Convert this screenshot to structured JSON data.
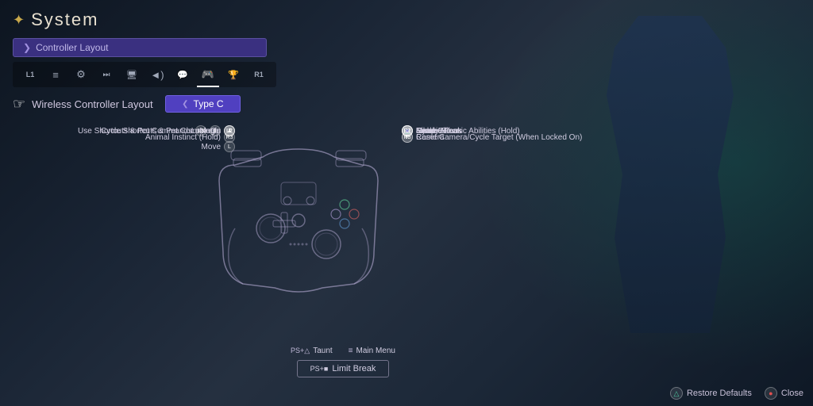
{
  "header": {
    "icon": "✦",
    "title": "System"
  },
  "controller_layout_bar": {
    "arrow": "❯",
    "label": "Controller Layout"
  },
  "tabs": [
    {
      "id": "l1",
      "label": "L1",
      "icon": "L1"
    },
    {
      "id": "list",
      "label": "≡",
      "icon": "≡"
    },
    {
      "id": "gear",
      "label": "⚙",
      "icon": "⚙"
    },
    {
      "id": "media",
      "label": "▶|",
      "icon": "▶|"
    },
    {
      "id": "display",
      "label": "□",
      "icon": "□"
    },
    {
      "id": "sound",
      "label": "♪",
      "icon": "◄►"
    },
    {
      "id": "speech",
      "label": "💬",
      "icon": "💬"
    },
    {
      "id": "controller",
      "label": "🎮",
      "icon": "🎮",
      "active": true
    },
    {
      "id": "trophy",
      "label": "🏆",
      "icon": "🏆"
    },
    {
      "id": "r1",
      "label": "R1",
      "icon": "R1"
    }
  ],
  "wireless_setting": {
    "label": "Wireless Controller Layout",
    "value": "Type C",
    "arrow": "❮"
  },
  "left_labels": [
    {
      "id": "lock-on",
      "text": "Lock On",
      "btn": "L1"
    },
    {
      "id": "magic",
      "text": "Magic",
      "btn": "L2"
    },
    {
      "id": "shortcuts-pet",
      "text": "Use Shortcuts & Pet Commands",
      "btn": "L3"
    },
    {
      "id": "cycle-shortcuts",
      "text": "Cycle Shortcuts & Pet Commands",
      "btn": "↑"
    },
    {
      "id": "move",
      "text": "Move",
      "btn": "L"
    },
    {
      "id": "animal-instinct",
      "text": "Animal Instinct (Hold)",
      "btn": "R3"
    }
  ],
  "right_labels": [
    {
      "id": "ready-eikonic",
      "text": "Ready Eikonic Abilities (Hold)",
      "btn": "R1"
    },
    {
      "id": "evade",
      "text": "Evade",
      "btn": "R2"
    },
    {
      "id": "cycle-eikons",
      "text": "Cycle Eikons",
      "btn": "↑"
    },
    {
      "id": "eikonic-feat",
      "text": "Eikonic Feat",
      "btn": "●"
    },
    {
      "id": "melee-attack",
      "text": "Melee Attack",
      "btn": "■"
    },
    {
      "id": "jump",
      "text": "Jump",
      "btn": "✕"
    },
    {
      "id": "camera",
      "text": "Camera",
      "btn": "R"
    },
    {
      "id": "reset-camera",
      "text": "Reset Camera/Cycle Target (When Locked On)",
      "btn": "R3"
    }
  ],
  "bottom_row": {
    "taunt_icon": "PS+△",
    "taunt_label": "Taunt",
    "menu_icon": "≡",
    "menu_label": "Main Menu"
  },
  "limit_break": {
    "icon": "PS+■",
    "label": "Limit Break"
  },
  "bottom_actions": [
    {
      "id": "restore-defaults",
      "btn_type": "triangle",
      "btn": "△",
      "label": "Restore Defaults"
    },
    {
      "id": "close",
      "btn_type": "circle",
      "btn": "●",
      "label": "Close"
    }
  ],
  "colors": {
    "accent_purple": "#5040c0",
    "tab_active_underline": "#ffffff",
    "header_gold": "#c8a84b"
  }
}
